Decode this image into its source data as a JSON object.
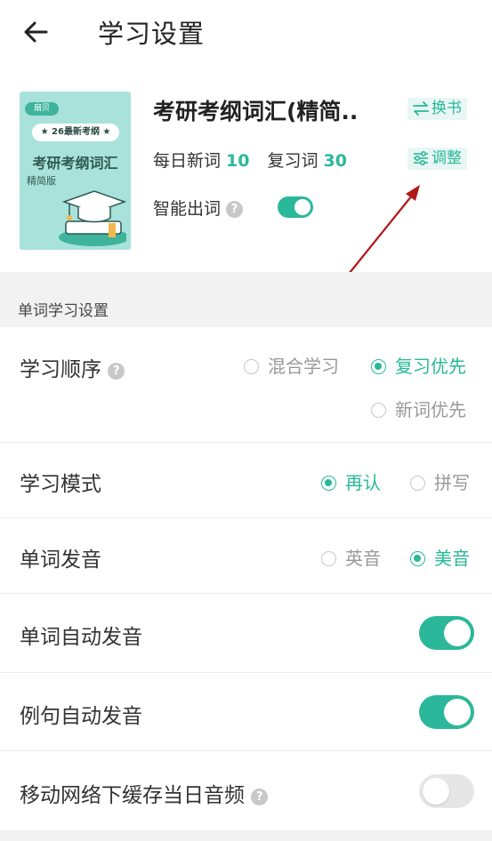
{
  "header": {
    "title": "学习设置",
    "back_icon": "arrow-left-icon"
  },
  "book": {
    "title": "考研考纲词汇(精简..",
    "cover": {
      "logo": "扇贝",
      "badge": "26最新考纲",
      "title": "考研考纲词汇",
      "subtitle": "精简版"
    },
    "change_label": "换书",
    "adjust_label": "调整",
    "daily_new_label": "每日新词",
    "daily_new_value": "10",
    "review_label": "复习词",
    "review_value": "30",
    "smart_label": "智能出词",
    "smart_on": true
  },
  "section": {
    "title": "单词学习设置"
  },
  "settings": {
    "order": {
      "label": "学习顺序",
      "options": [
        "混合学习",
        "复习优先",
        "新词优先"
      ],
      "selected": "复习优先"
    },
    "mode": {
      "label": "学习模式",
      "options": [
        "再认",
        "拼写"
      ],
      "selected": "再认"
    },
    "pronunciation": {
      "label": "单词发音",
      "options": [
        "英音",
        "美音"
      ],
      "selected": "美音"
    },
    "auto_word": {
      "label": "单词自动发音",
      "on": true
    },
    "auto_sentence": {
      "label": "例句自动发音",
      "on": true
    },
    "cache_audio": {
      "label": "移动网络下缓存当日音频",
      "on": false
    }
  },
  "colors": {
    "accent": "#2bb89a",
    "annotation_arrow": "#b01818"
  }
}
